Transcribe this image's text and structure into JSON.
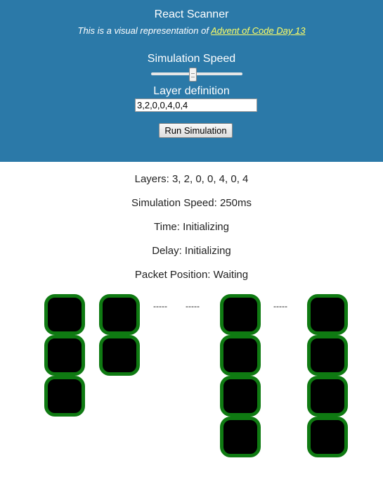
{
  "header": {
    "title": "React Scanner",
    "subtitle_prefix": "This is a visual representation of ",
    "subtitle_link": "Advent of Code Day 13",
    "speed_label": "Simulation Speed",
    "speed_value_fraction": 0.45,
    "layer_label": "Layer definition",
    "layer_input_value": "3,2,0,0,4,0,4",
    "run_button_label": "Run Simulation"
  },
  "status": {
    "layers": "Layers: 3, 2, 0, 0, 4, 0, 4",
    "speed": "Simulation Speed: 250ms",
    "time": "Time: Initializing",
    "delay": "Delay: Initializing",
    "packet_position": "Packet Position: Waiting"
  },
  "scanner": {
    "layers": [
      3,
      2,
      0,
      0,
      4,
      0,
      4
    ],
    "empty_marker": "-----"
  },
  "colors": {
    "header_bg": "#2b79a8",
    "link": "#ffff66",
    "cell_border": "#0f7a12",
    "cell_fill": "#000000"
  }
}
